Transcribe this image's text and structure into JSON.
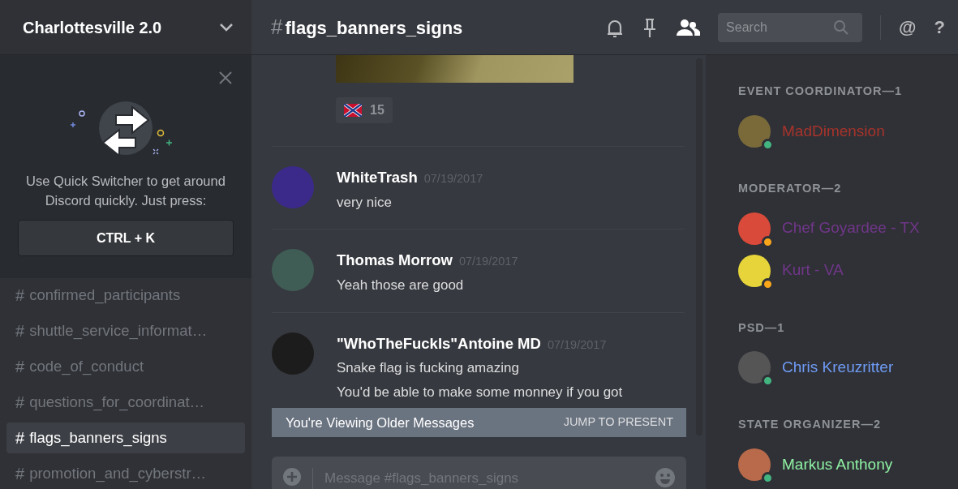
{
  "server": {
    "name": "Charlottesville 2.0"
  },
  "quick_switcher": {
    "text": "Use Quick Switcher to get around Discord quickly. Just press:",
    "shortcut": "CTRL + K"
  },
  "channels": [
    {
      "hash": "#",
      "name": "confirmed_participants",
      "selected": false
    },
    {
      "hash": "#",
      "name": "shuttle_service_informat…",
      "selected": false
    },
    {
      "hash": "#",
      "name": "code_of_conduct",
      "selected": false
    },
    {
      "hash": "#",
      "name": "questions_for_coordinat…",
      "selected": false
    },
    {
      "hash": "#",
      "name": "flags_banners_signs",
      "selected": true
    },
    {
      "hash": "#",
      "name": "promotion_and_cyberstr…",
      "selected": false
    }
  ],
  "header": {
    "hash": "#",
    "channel": "flags_banners_signs",
    "search_placeholder": "Search",
    "at": "@",
    "help": "?"
  },
  "reaction": {
    "count": "15"
  },
  "messages": [
    {
      "author": "WhiteTrash",
      "time": "07/19/2017",
      "lines": [
        "very nice"
      ],
      "color": "#3b2a8a"
    },
    {
      "author": "Thomas Morrow",
      "time": "07/19/2017",
      "lines": [
        "Yeah those are good"
      ],
      "color": "#3f5d55"
    },
    {
      "author": "\"WhoTheFuckIs\"Antoine MD",
      "time": "07/19/2017",
      "lines": [
        "Snake flag is fucking amazing",
        "You'd be able to make some monney if you got"
      ],
      "color": "#1c1c1c"
    }
  ],
  "older_banner": {
    "text": "You're Viewing Older Messages",
    "action": "JUMP TO PRESENT"
  },
  "composer": {
    "placeholder": "Message #flags_banners_signs"
  },
  "member_groups": [
    {
      "title": "EVENT COORDINATOR—1",
      "members": [
        {
          "name": "MadDimension",
          "color": "#a8332b",
          "idle": false
        }
      ]
    },
    {
      "title": "MODERATOR—2",
      "members": [
        {
          "name": "Chef Goyardee - TX",
          "color": "#71368a",
          "idle": true
        },
        {
          "name": "Kurt - VA",
          "color": "#71368a",
          "idle": true
        }
      ]
    },
    {
      "title": "PSD—1",
      "members": [
        {
          "name": "Chris Kreuzritter",
          "color": "#6f9bf5",
          "idle": false
        }
      ]
    },
    {
      "title": "STATE ORGANIZER—2",
      "members": [
        {
          "name": "Markus Anthony",
          "color": "#8ff0a4",
          "idle": false
        }
      ]
    }
  ]
}
